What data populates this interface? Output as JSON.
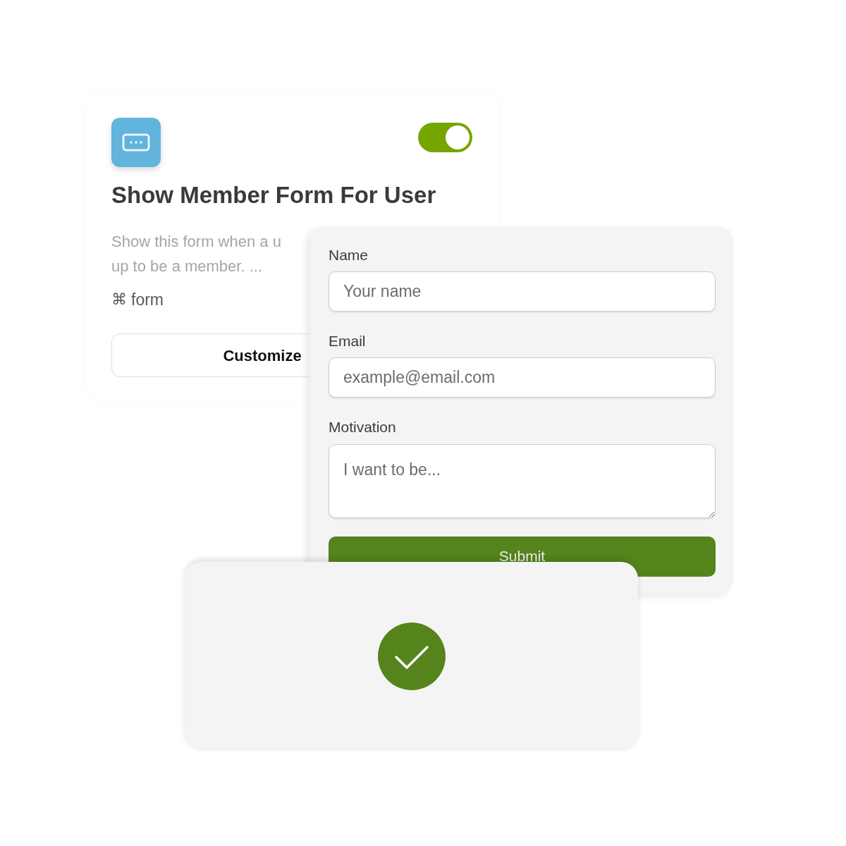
{
  "rule_card": {
    "title": "Show Member Form For User",
    "description_lines": [
      "Show this form when a u",
      "up to be a member. ..."
    ],
    "tag_symbol": "⌘",
    "tag": "form",
    "enabled": true,
    "button": "Customize"
  },
  "form": {
    "fields": [
      {
        "kind": "input",
        "label": "Name",
        "placeholder": "Your name"
      },
      {
        "kind": "input",
        "label": "Email",
        "placeholder": "example@email.com"
      },
      {
        "kind": "textarea",
        "label": "Motivation",
        "placeholder": "I want to be..."
      }
    ],
    "submit": "Submit"
  }
}
